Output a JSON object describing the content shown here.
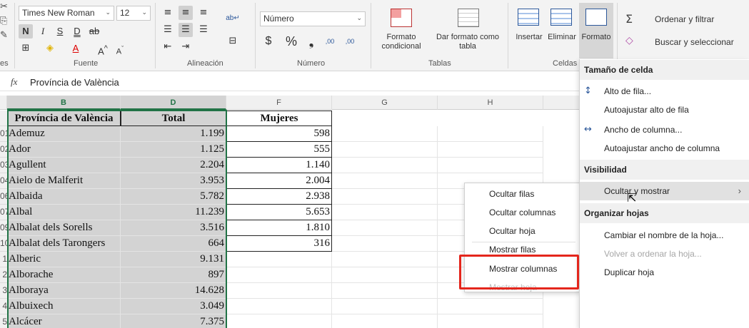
{
  "ribbon": {
    "font": {
      "name": "Times New Roman",
      "size": "12",
      "group_label": "Fuente"
    },
    "alignment": {
      "group_label": "Alineación"
    },
    "number": {
      "format": "Número",
      "group_label": "Número",
      "currency": "$",
      "percent": "%",
      "thousands": "❟",
      "inc_decimals": ",00",
      "dec_decimals": ",00"
    },
    "tables": {
      "group_label": "Tablas",
      "conditional_format": "Formato condicional",
      "format_as_table": "Dar formato como tabla"
    },
    "cells": {
      "group_label": "Celdas",
      "insert": "Insertar",
      "delete": "Eliminar",
      "format": "Formato"
    },
    "editing": {
      "sort_filter": "Ordenar y filtrar",
      "find_select": "Buscar y seleccionar"
    },
    "left_partial_label": "es"
  },
  "formula_bar": {
    "fx": "fx",
    "value": "Província de València"
  },
  "columns": [
    {
      "label": "B",
      "selected": true
    },
    {
      "label": "D",
      "selected": true
    },
    {
      "label": "F",
      "selected": false
    },
    {
      "label": "G",
      "selected": false
    },
    {
      "label": "H",
      "selected": false
    }
  ],
  "table": {
    "headers": [
      "Província de València",
      "Total",
      "Mujeres"
    ],
    "rows": [
      {
        "rn": "01",
        "name": "Ademuz",
        "total": "1.199",
        "mujeres": "598"
      },
      {
        "rn": "02",
        "name": "Ador",
        "total": "1.125",
        "mujeres": "555"
      },
      {
        "rn": "03",
        "name": "Agullent",
        "total": "2.204",
        "mujeres": "1.140"
      },
      {
        "rn": "04",
        "name": "Aielo de Malferit",
        "total": "3.953",
        "mujeres": "2.004"
      },
      {
        "rn": "06",
        "name": "Albaida",
        "total": "5.782",
        "mujeres": "2.938"
      },
      {
        "rn": "07",
        "name": "Albal",
        "total": "11.239",
        "mujeres": "5.653"
      },
      {
        "rn": "09",
        "name": "Albalat dels Sorells",
        "total": "3.516",
        "mujeres": "1.810"
      },
      {
        "rn": "10",
        "name": "Albalat dels Tarongers",
        "total": "664",
        "mujeres": "316"
      },
      {
        "rn": "1",
        "name": "Alberic",
        "total": "9.131",
        "mujeres": ""
      },
      {
        "rn": "2",
        "name": "Alborache",
        "total": "897",
        "mujeres": ""
      },
      {
        "rn": "3",
        "name": "Alboraya",
        "total": "14.628",
        "mujeres": ""
      },
      {
        "rn": "4",
        "name": "Albuixech",
        "total": "3.049",
        "mujeres": ""
      },
      {
        "rn": "5",
        "name": "Alcácer",
        "total": "7.375",
        "mujeres": ""
      }
    ]
  },
  "submenu": {
    "items": [
      {
        "label": "Ocultar filas"
      },
      {
        "label": "Ocultar columnas"
      },
      {
        "label": "Ocultar hoja"
      },
      {
        "label": "Mostrar filas"
      },
      {
        "label": "Mostrar columnas"
      },
      {
        "label": "Mostrar hoja"
      }
    ]
  },
  "format_menu": {
    "section_cell_size": "Tamaño de celda",
    "row_height": "Alto de fila...",
    "autofit_row": "Autoajustar alto de fila",
    "col_width": "Ancho de columna...",
    "autofit_col": "Autoajustar ancho de columna",
    "section_visibility": "Visibilidad",
    "hide_show": "Ocultar y mostrar",
    "section_organize": "Organizar hojas",
    "rename_sheet": "Cambiar el nombre de la hoja...",
    "reorder_sheet": "Volver a ordenar la hoja...",
    "duplicate_sheet": "Duplicar hoja"
  },
  "colors": {
    "selection_gray": "#d3d3d3",
    "highlight_red": "#e4261c",
    "accent_green": "#217346"
  }
}
